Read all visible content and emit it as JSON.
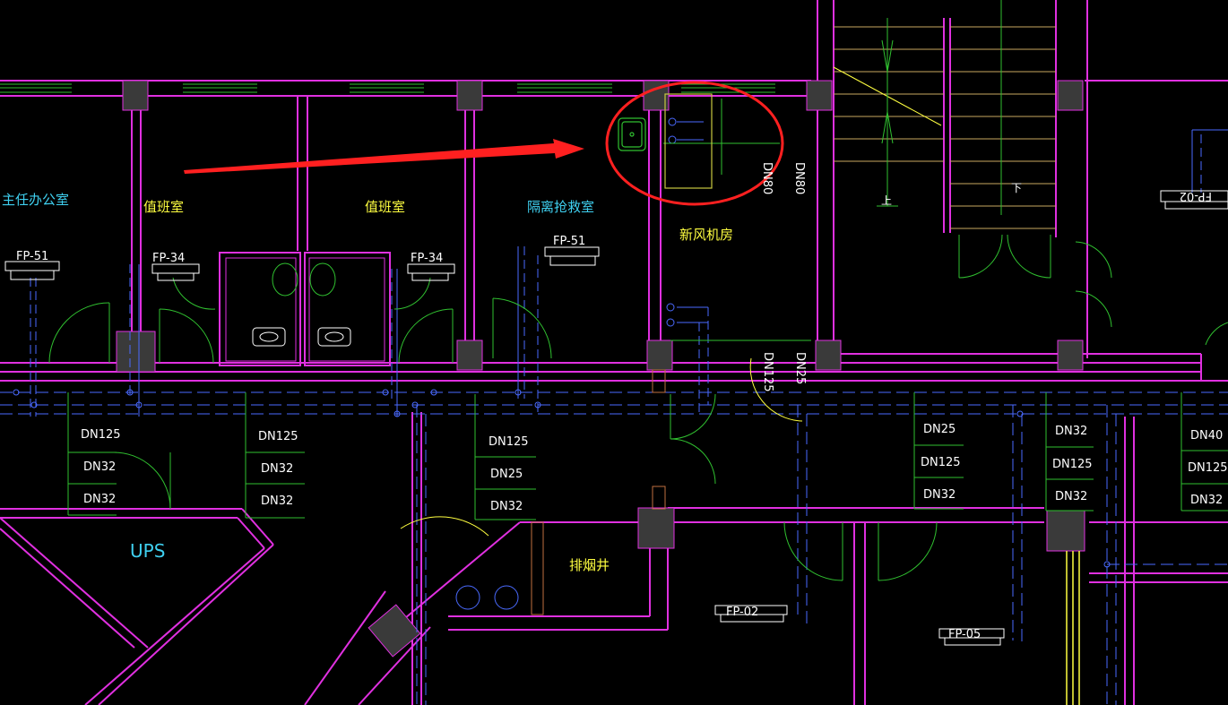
{
  "colors": {
    "background": "#000000",
    "wall": "#e030e0",
    "window": "#30c030",
    "pipe": "#4a6aff",
    "door": "#30c030",
    "column": "#3a3a3a",
    "room_label": "#ffff40",
    "room_label_alt": "#3fd0f0",
    "pipe_label": "#ffffff",
    "annotation": "#ff2020"
  },
  "rooms": {
    "director_office": "主任办公室",
    "duty_room_1": "值班室",
    "duty_room_2": "值班室",
    "isolation_room": "隔离抢救室",
    "fresh_air_room": "新风机房",
    "smoke_shaft": "排烟井",
    "ups": "UPS"
  },
  "equipment": {
    "fp51_left": "FP-51",
    "fp34_left": "FP-34",
    "fp34_right": "FP-34",
    "fp51_mid": "FP-51",
    "fp_bottom_1": "FP-02",
    "fp_bottom_2": "FP-05",
    "fp_top_right": "FP-02"
  },
  "pipe_labels": {
    "col1": [
      "DN125",
      "DN32",
      "DN32"
    ],
    "col2": [
      "DN125",
      "DN32",
      "DN32"
    ],
    "col3": [
      "DN125",
      "DN25",
      "DN32"
    ],
    "col4": [
      "DN25",
      "DN125",
      "DN32"
    ],
    "col5": [
      "DN32",
      "DN125",
      "DN32"
    ],
    "col6": [
      "DN40",
      "DN125",
      "DN32"
    ],
    "vertical_dn80_a": "DN80",
    "vertical_dn80_b": "DN80",
    "vertical_dn125": "DN125",
    "vertical_dn25": "DN25"
  },
  "stair_labels": {
    "down": "下",
    "up": "上"
  }
}
